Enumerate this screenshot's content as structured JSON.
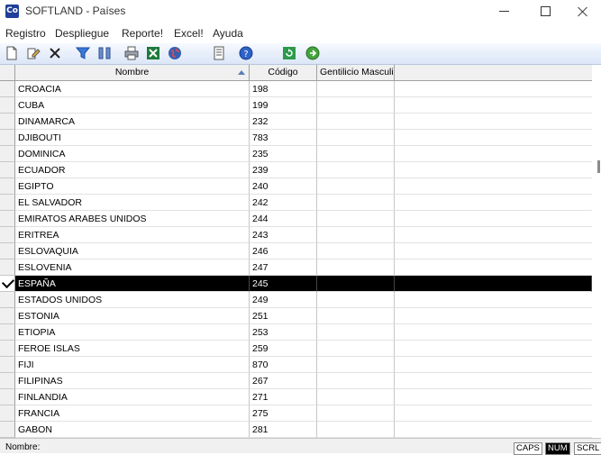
{
  "window": {
    "title": "SOFTLAND - Países",
    "app_icon_text": "Co"
  },
  "menu": [
    "Registro",
    "Despliegue",
    "Reporte!",
    "Excel!",
    "Ayuda"
  ],
  "toolbar": [
    "new-document-icon",
    "edit-icon",
    "delete-icon",
    "filter-icon",
    "columns-icon",
    "print-icon",
    "excel-icon",
    "globe-icon",
    "report-icon",
    "help-icon",
    "refresh-icon",
    "navigate-icon"
  ],
  "grid": {
    "columns": [
      {
        "label": "Nombre"
      },
      {
        "label": "Código"
      },
      {
        "label": "Gentilicio Masculir"
      }
    ],
    "rows": [
      {
        "name": "CROACIA",
        "code": "198",
        "gentilicio": ""
      },
      {
        "name": "CUBA",
        "code": "199",
        "gentilicio": ""
      },
      {
        "name": "DINAMARCA",
        "code": "232",
        "gentilicio": ""
      },
      {
        "name": "DJIBOUTI",
        "code": "783",
        "gentilicio": ""
      },
      {
        "name": "DOMINICA",
        "code": "235",
        "gentilicio": ""
      },
      {
        "name": "ECUADOR",
        "code": "239",
        "gentilicio": ""
      },
      {
        "name": "EGIPTO",
        "code": "240",
        "gentilicio": ""
      },
      {
        "name": "EL SALVADOR",
        "code": "242",
        "gentilicio": ""
      },
      {
        "name": "EMIRATOS ARABES UNIDOS",
        "code": "244",
        "gentilicio": ""
      },
      {
        "name": "ERITREA",
        "code": "243",
        "gentilicio": ""
      },
      {
        "name": "ESLOVAQUIA",
        "code": "246",
        "gentilicio": ""
      },
      {
        "name": "ESLOVENIA",
        "code": "247",
        "gentilicio": ""
      },
      {
        "name": "ESPAÑA",
        "code": "245",
        "gentilicio": "",
        "selected": true
      },
      {
        "name": "ESTADOS UNIDOS",
        "code": "249",
        "gentilicio": ""
      },
      {
        "name": "ESTONIA",
        "code": "251",
        "gentilicio": ""
      },
      {
        "name": "ETIOPIA",
        "code": "253",
        "gentilicio": ""
      },
      {
        "name": "FEROE  ISLAS",
        "code": "259",
        "gentilicio": ""
      },
      {
        "name": "FIJI",
        "code": "870",
        "gentilicio": ""
      },
      {
        "name": "FILIPINAS",
        "code": "267",
        "gentilicio": ""
      },
      {
        "name": "FINLANDIA",
        "code": "271",
        "gentilicio": ""
      },
      {
        "name": "FRANCIA",
        "code": "275",
        "gentilicio": ""
      },
      {
        "name": "GABON",
        "code": "281",
        "gentilicio": ""
      }
    ]
  },
  "status": {
    "label": "Nombre:",
    "caps": "CAPS",
    "num": "NUM",
    "scrl": "SCRL"
  }
}
